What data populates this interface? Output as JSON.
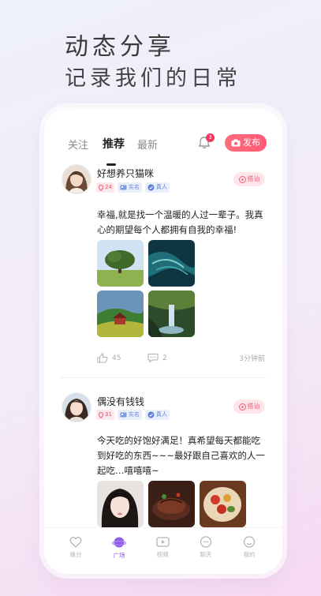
{
  "headline": {
    "line1": "动态分享",
    "line2": "记录我们的日常"
  },
  "tabs": [
    {
      "label": "关注",
      "active": false
    },
    {
      "label": "推荐",
      "active": true
    },
    {
      "label": "最新",
      "active": false
    }
  ],
  "notification_count": "3",
  "publish_label": "发布",
  "posts": [
    {
      "username": "好想养只猫咪",
      "location": "24",
      "real_name_badge": "实名",
      "verified_badge": "真人",
      "greet_label": "搭讪",
      "content": "幸福,就是找一个温暖的人过一辈子。我真心的期望每个人都拥有自我的幸福!",
      "images": [
        "tree-field",
        "ocean-swirl",
        "red-house-hills",
        "forest-waterfall"
      ],
      "likes": "45",
      "comments": "2",
      "time": "3分钟前"
    },
    {
      "username": "偶没有钱钱",
      "location": "31",
      "real_name_badge": "实名",
      "verified_badge": "真人",
      "greet_label": "搭讪",
      "content": "今天吃的好饱好满足！真希望每天都能吃到好吃的东西~~~最好跟自己喜欢的人一起吃…嘻嘻嘻~",
      "images": [
        "girl-portrait",
        "steak",
        "salad-plate"
      ]
    }
  ],
  "nav": [
    {
      "label": "缘分",
      "icon": "heart-icon",
      "active": false
    },
    {
      "label": "广场",
      "icon": "planet-icon",
      "active": true
    },
    {
      "label": "视频",
      "icon": "video-icon",
      "active": false
    },
    {
      "label": "聊天",
      "icon": "chat-icon",
      "active": false
    },
    {
      "label": "我的",
      "icon": "profile-icon",
      "active": false
    }
  ],
  "colors": {
    "accent": "#ff5a7a",
    "nav_active": "#8f5de8"
  }
}
